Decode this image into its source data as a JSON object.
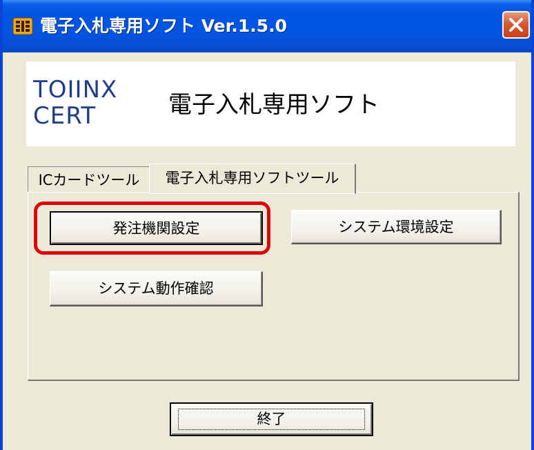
{
  "window": {
    "title": "電子入札専用ソフト Ver.1.5.0",
    "icon": "ic-card-app-icon",
    "close_icon": "close-x-icon"
  },
  "banner": {
    "logo_line1": "TOIINX",
    "logo_line2": "CERT",
    "title": "電子入札専用ソフト"
  },
  "tabs": [
    {
      "label": "ICカードツール",
      "selected": false
    },
    {
      "label": "電子入札専用ソフトツール",
      "selected": true
    }
  ],
  "buttons": {
    "ordering_agency_settings": "発注機関設定",
    "system_env_settings": "システム環境設定",
    "system_operation_check": "システム動作確認",
    "exit": "終了"
  },
  "colors": {
    "titlebar": "#0054e3",
    "highlight": "#e0000a",
    "logo": "#1f3d8a",
    "dialog_bg": "#ece9d8"
  }
}
